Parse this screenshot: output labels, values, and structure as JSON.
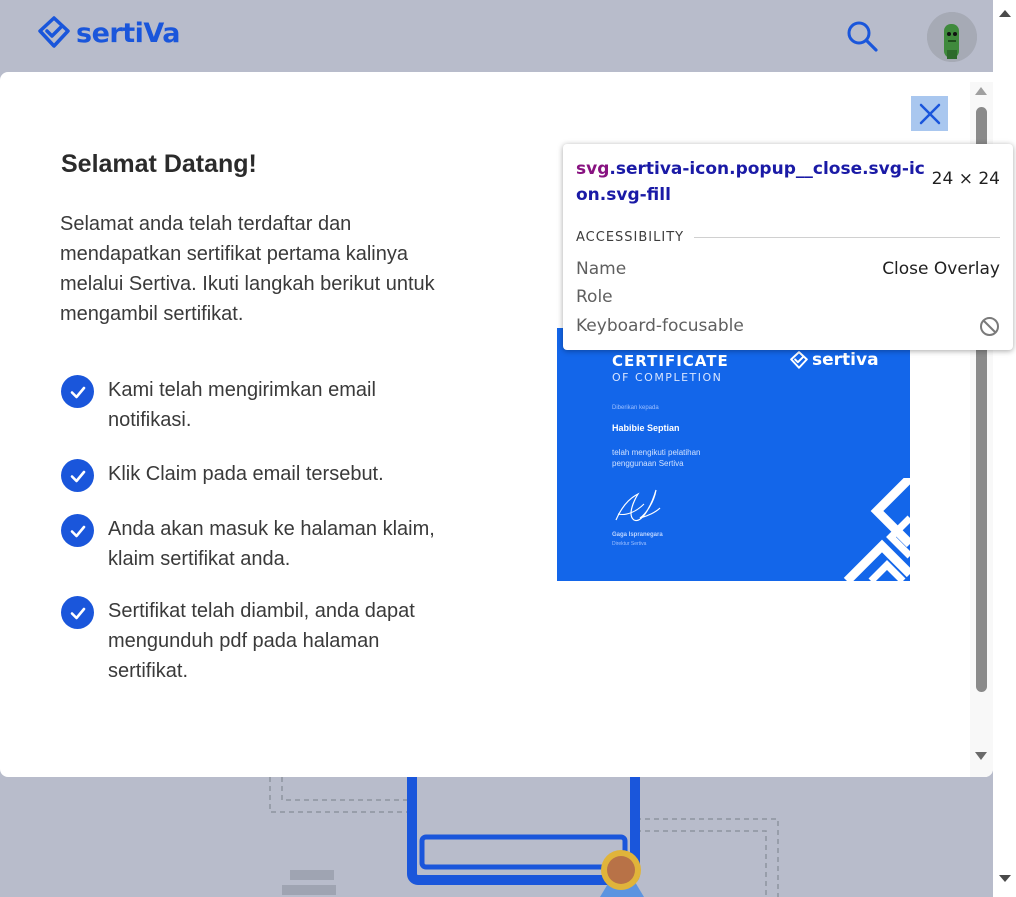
{
  "header": {
    "logo_text": "sertiVa"
  },
  "modal": {
    "title": "Selamat Datang!",
    "intro": "Selamat anda telah terdaftar dan mendapatkan sertifikat pertama kalinya melalui Sertiva. Ikuti langkah berikut untuk mengambil sertifikat.",
    "steps": [
      "Kami telah mengirimkan email notifikasi.",
      "Klik Claim pada email tersebut.",
      "Anda akan masuk ke halaman klaim, klaim sertifikat anda.",
      "Sertifikat telah diambil, anda dapat mengunduh pdf pada halaman sertifikat."
    ]
  },
  "certificate": {
    "title": "CERTIFICATE",
    "subtitle": "OF COMPLETION",
    "logo_text": "sertiva",
    "given_to": "Diberikan kepada",
    "recipient": "Habibie Septian",
    "description": "telah mengikuti pelatihan penggunaan Sertiva",
    "signer": "Gaga Ispranegara",
    "signer_role": "Direktur Sertiva"
  },
  "tooltip": {
    "selector_tag": "svg",
    "selector_classes": ".sertiva-icon.popup__close.svg-icon.svg-fill",
    "size": "24 × 24",
    "section_label": "ACCESSIBILITY",
    "rows": [
      {
        "label": "Name",
        "value": "Close Overlay"
      },
      {
        "label": "Role",
        "value": ""
      },
      {
        "label": "Keyboard-focusable",
        "value": ""
      }
    ]
  },
  "colors": {
    "brand": "#1a56db",
    "certificate_bg": "#1366ea",
    "close_highlight": "#a9c7ef",
    "backdrop": "#b8bccb"
  },
  "icons": {
    "logo": "sertiva-logo-icon",
    "search": "search-icon",
    "close": "close-icon",
    "check": "check-icon",
    "not_allowed": "not-allowed-icon"
  }
}
